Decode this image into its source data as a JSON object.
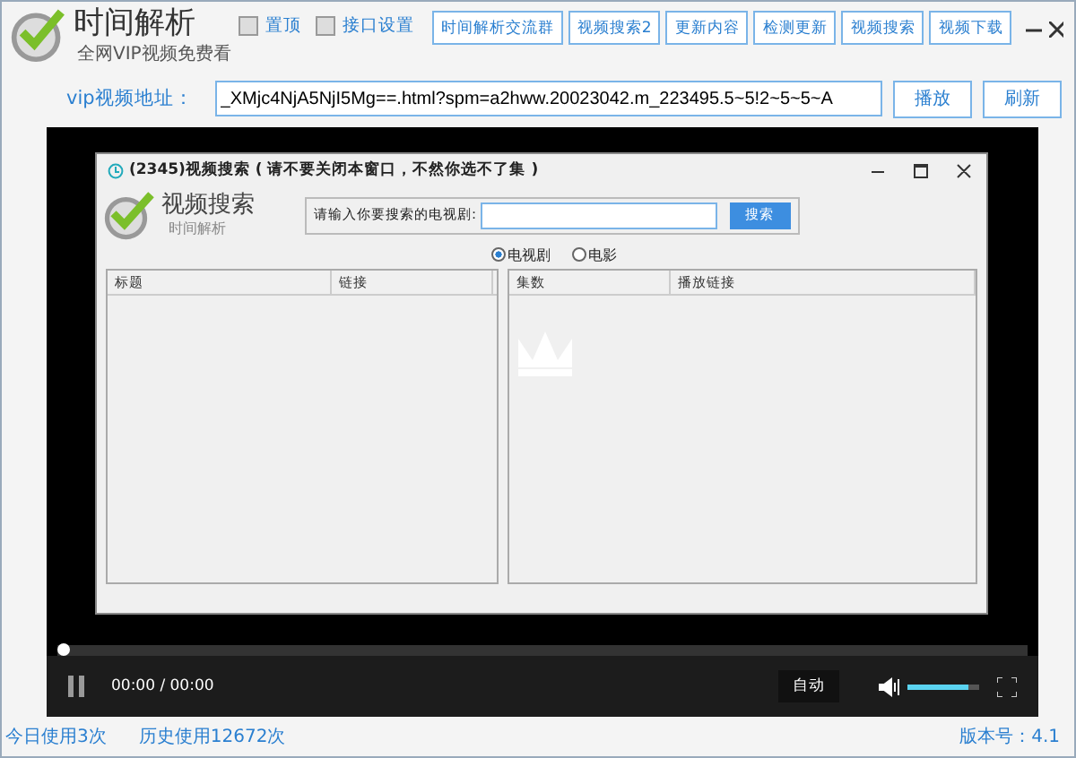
{
  "app": {
    "title": "时间解析",
    "subtitle": "全网VIP视频免费看"
  },
  "options": [
    {
      "label": "置顶",
      "checked": false
    },
    {
      "label": "接口设置",
      "checked": false
    }
  ],
  "toolbar_buttons": [
    "时间解析交流群",
    "视频搜索2",
    "更新内容",
    "检测更新",
    "视频搜索",
    "视频下载"
  ],
  "address": {
    "label": "vip视频地址：",
    "value": "_XMjc4NjA5NjI5Mg==.html?spm=a2hww.20023042.m_223495.5~5!2~5~5~A",
    "buttons": [
      "播放",
      "刷新"
    ]
  },
  "dialog": {
    "title": "(2345)视频搜索 ( 请不要关闭本窗口，不然你选不了集 )",
    "logo_title": "视频搜索",
    "logo_subtitle": "时间解析",
    "search_label": "请输入你要搜索的电视剧:",
    "search_button": "搜索",
    "types": [
      {
        "label": "电视剧",
        "selected": true
      },
      {
        "label": "电影",
        "selected": false
      }
    ],
    "left_columns": [
      "标题",
      "链接"
    ],
    "right_columns": [
      "集数",
      "播放链接"
    ]
  },
  "player": {
    "progress": {
      "level": 0
    },
    "time": "00:00 / 00:00",
    "quality": "自动",
    "volume": {
      "level": 0.85
    }
  },
  "status_bar": {
    "today": "今日使用3次",
    "history": "历史使用12672次",
    "version": "版本号：4.1"
  }
}
